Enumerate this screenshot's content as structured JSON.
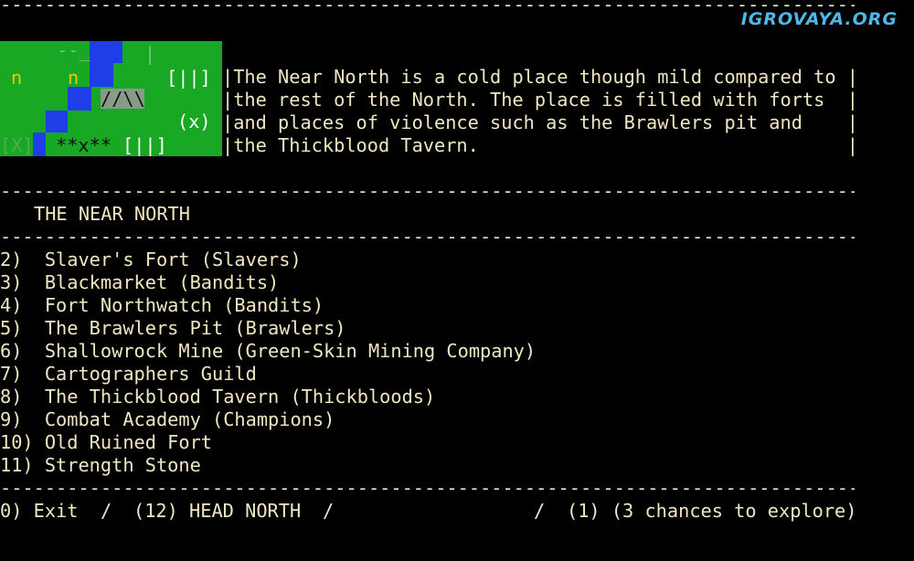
{
  "watermark": "IGROVAYA.ORG",
  "divider": "------------------------------------------------------------------------------------------",
  "map": {
    "cells": {
      "top_marks": "--_",
      "tick": "|",
      "n1": "n",
      "n2": "n",
      "door_top": "[||]",
      "ruin": "//\\\\",
      "x_marker": "(x)",
      "boxed_x": "[X]",
      "stars": "**x**",
      "door_bottom": "[||]"
    }
  },
  "description": [
    "|The Near North is a cold place though mild compared to |",
    "|the rest of the North. The place is filled with forts  |",
    "|and places of violence such as the Brawlers pit and    |",
    "|the Thickblood Tavern.                                 |"
  ],
  "location_title": "THE NEAR NORTH",
  "menu_items": [
    "2)  Slaver's Fort (Slavers)",
    "3)  Blackmarket (Bandits)",
    "4)  Fort Northwatch (Bandits)",
    "5)  The Brawlers Pit (Brawlers)",
    "6)  Shallowrock Mine (Green-Skin Mining Company)",
    "7)  Cartographers Guild",
    "8)  The Thickblood Tavern (Thickbloods)",
    "9)  Combat Academy (Champions)",
    "10) Old Ruined Fort",
    "11) Strength Stone"
  ],
  "footer": {
    "exit": "0) Exit",
    "sep1": "/",
    "head_north": "(12) HEAD NORTH",
    "sep2": "/",
    "sep3": "/",
    "explore": "(1) (3 chances to explore)"
  },
  "colors": {
    "text": "#f1e6c2",
    "map_green": "#18a824",
    "map_blue": "#1e3ee8",
    "watermark": "#4fb7e6"
  }
}
